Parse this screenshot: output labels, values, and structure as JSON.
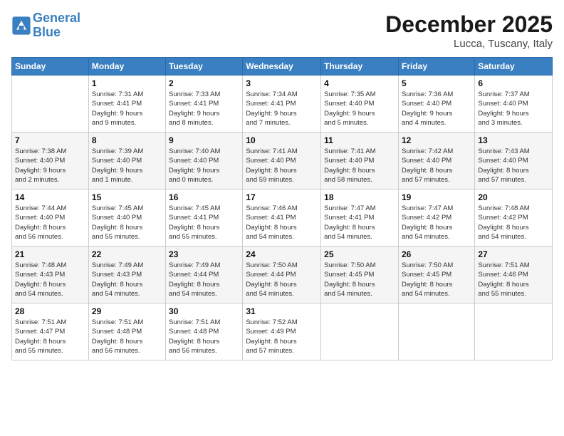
{
  "logo": {
    "line1": "General",
    "line2": "Blue"
  },
  "title": "December 2025",
  "location": "Lucca, Tuscany, Italy",
  "days_of_week": [
    "Sunday",
    "Monday",
    "Tuesday",
    "Wednesday",
    "Thursday",
    "Friday",
    "Saturday"
  ],
  "weeks": [
    [
      {
        "num": "",
        "info": ""
      },
      {
        "num": "1",
        "info": "Sunrise: 7:31 AM\nSunset: 4:41 PM\nDaylight: 9 hours\nand 9 minutes."
      },
      {
        "num": "2",
        "info": "Sunrise: 7:33 AM\nSunset: 4:41 PM\nDaylight: 9 hours\nand 8 minutes."
      },
      {
        "num": "3",
        "info": "Sunrise: 7:34 AM\nSunset: 4:41 PM\nDaylight: 9 hours\nand 7 minutes."
      },
      {
        "num": "4",
        "info": "Sunrise: 7:35 AM\nSunset: 4:40 PM\nDaylight: 9 hours\nand 5 minutes."
      },
      {
        "num": "5",
        "info": "Sunrise: 7:36 AM\nSunset: 4:40 PM\nDaylight: 9 hours\nand 4 minutes."
      },
      {
        "num": "6",
        "info": "Sunrise: 7:37 AM\nSunset: 4:40 PM\nDaylight: 9 hours\nand 3 minutes."
      }
    ],
    [
      {
        "num": "7",
        "info": "Sunrise: 7:38 AM\nSunset: 4:40 PM\nDaylight: 9 hours\nand 2 minutes."
      },
      {
        "num": "8",
        "info": "Sunrise: 7:39 AM\nSunset: 4:40 PM\nDaylight: 9 hours\nand 1 minute."
      },
      {
        "num": "9",
        "info": "Sunrise: 7:40 AM\nSunset: 4:40 PM\nDaylight: 9 hours\nand 0 minutes."
      },
      {
        "num": "10",
        "info": "Sunrise: 7:41 AM\nSunset: 4:40 PM\nDaylight: 8 hours\nand 59 minutes."
      },
      {
        "num": "11",
        "info": "Sunrise: 7:41 AM\nSunset: 4:40 PM\nDaylight: 8 hours\nand 58 minutes."
      },
      {
        "num": "12",
        "info": "Sunrise: 7:42 AM\nSunset: 4:40 PM\nDaylight: 8 hours\nand 57 minutes."
      },
      {
        "num": "13",
        "info": "Sunrise: 7:43 AM\nSunset: 4:40 PM\nDaylight: 8 hours\nand 57 minutes."
      }
    ],
    [
      {
        "num": "14",
        "info": "Sunrise: 7:44 AM\nSunset: 4:40 PM\nDaylight: 8 hours\nand 56 minutes."
      },
      {
        "num": "15",
        "info": "Sunrise: 7:45 AM\nSunset: 4:40 PM\nDaylight: 8 hours\nand 55 minutes."
      },
      {
        "num": "16",
        "info": "Sunrise: 7:45 AM\nSunset: 4:41 PM\nDaylight: 8 hours\nand 55 minutes."
      },
      {
        "num": "17",
        "info": "Sunrise: 7:46 AM\nSunset: 4:41 PM\nDaylight: 8 hours\nand 54 minutes."
      },
      {
        "num": "18",
        "info": "Sunrise: 7:47 AM\nSunset: 4:41 PM\nDaylight: 8 hours\nand 54 minutes."
      },
      {
        "num": "19",
        "info": "Sunrise: 7:47 AM\nSunset: 4:42 PM\nDaylight: 8 hours\nand 54 minutes."
      },
      {
        "num": "20",
        "info": "Sunrise: 7:48 AM\nSunset: 4:42 PM\nDaylight: 8 hours\nand 54 minutes."
      }
    ],
    [
      {
        "num": "21",
        "info": "Sunrise: 7:48 AM\nSunset: 4:43 PM\nDaylight: 8 hours\nand 54 minutes."
      },
      {
        "num": "22",
        "info": "Sunrise: 7:49 AM\nSunset: 4:43 PM\nDaylight: 8 hours\nand 54 minutes."
      },
      {
        "num": "23",
        "info": "Sunrise: 7:49 AM\nSunset: 4:44 PM\nDaylight: 8 hours\nand 54 minutes."
      },
      {
        "num": "24",
        "info": "Sunrise: 7:50 AM\nSunset: 4:44 PM\nDaylight: 8 hours\nand 54 minutes."
      },
      {
        "num": "25",
        "info": "Sunrise: 7:50 AM\nSunset: 4:45 PM\nDaylight: 8 hours\nand 54 minutes."
      },
      {
        "num": "26",
        "info": "Sunrise: 7:50 AM\nSunset: 4:45 PM\nDaylight: 8 hours\nand 54 minutes."
      },
      {
        "num": "27",
        "info": "Sunrise: 7:51 AM\nSunset: 4:46 PM\nDaylight: 8 hours\nand 55 minutes."
      }
    ],
    [
      {
        "num": "28",
        "info": "Sunrise: 7:51 AM\nSunset: 4:47 PM\nDaylight: 8 hours\nand 55 minutes."
      },
      {
        "num": "29",
        "info": "Sunrise: 7:51 AM\nSunset: 4:48 PM\nDaylight: 8 hours\nand 56 minutes."
      },
      {
        "num": "30",
        "info": "Sunrise: 7:51 AM\nSunset: 4:48 PM\nDaylight: 8 hours\nand 56 minutes."
      },
      {
        "num": "31",
        "info": "Sunrise: 7:52 AM\nSunset: 4:49 PM\nDaylight: 8 hours\nand 57 minutes."
      },
      {
        "num": "",
        "info": ""
      },
      {
        "num": "",
        "info": ""
      },
      {
        "num": "",
        "info": ""
      }
    ]
  ]
}
